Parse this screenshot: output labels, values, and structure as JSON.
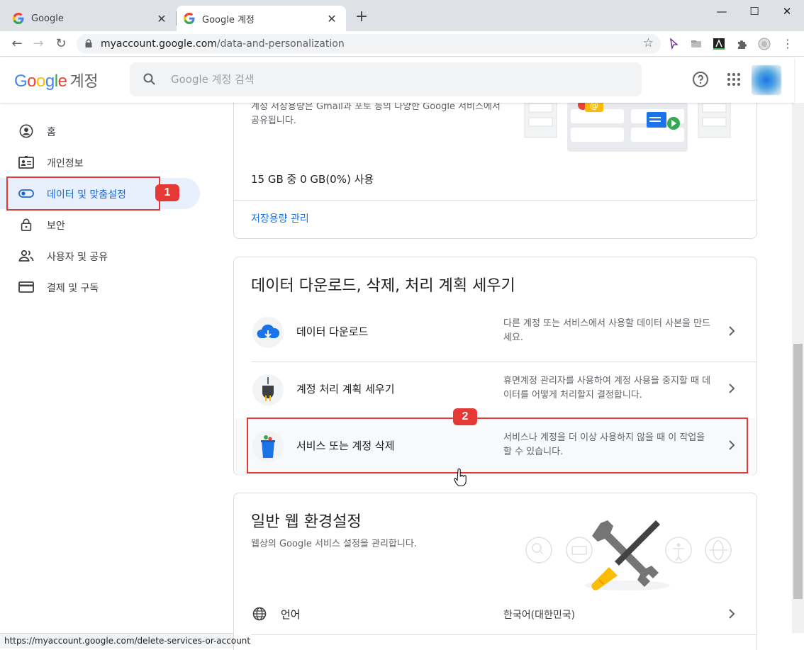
{
  "browser": {
    "tabs": [
      {
        "label": "Google",
        "active": false
      },
      {
        "label": "Google 계정",
        "active": true
      }
    ],
    "new_tab_label": "+",
    "url_domain": "myaccount.google.com",
    "url_path": "/data-and-personalization",
    "status_url": "https://myaccount.google.com/delete-services-or-account"
  },
  "header": {
    "logo_text": "Google",
    "account_label": "계정",
    "search_placeholder": "Google 계정 검색"
  },
  "sidebar": {
    "items": [
      {
        "label": "홈",
        "icon": "account-circle-icon"
      },
      {
        "label": "개인정보",
        "icon": "id-card-icon"
      },
      {
        "label": "데이터 및 맞춤설정",
        "icon": "toggle-icon",
        "active": true
      },
      {
        "label": "보안",
        "icon": "lock-icon"
      },
      {
        "label": "사용자 및 공유",
        "icon": "people-icon"
      },
      {
        "label": "결제 및 구독",
        "icon": "credit-card-icon"
      }
    ]
  },
  "annotations": {
    "badge1": "1",
    "badge2": "2",
    "accent": "#e53935"
  },
  "storage_card": {
    "description": "계정 저장용량은 Gmail과 포토 등의 다양한 Google 서비스에서 공유됩니다.",
    "usage": "15 GB 중 0 GB(0%) 사용",
    "usage_fraction": 0,
    "manage_link": "저장용량 관리"
  },
  "data_card": {
    "title": "데이터 다운로드, 삭제, 처리 계획 세우기",
    "rows": [
      {
        "title": "데이터 다운로드",
        "desc": "다른 계정 또는 서비스에서 사용할 데이터 사본을 만드세요.",
        "icon": "cloud-download-icon"
      },
      {
        "title": "계정 처리 계획 세우기",
        "desc": "휴면계정 관리자를 사용하여 계정 사용을 중지할 때 데이터를 어떻게 처리할지 결정합니다.",
        "icon": "plug-icon"
      },
      {
        "title": "서비스 또는 계정 삭제",
        "desc": "서비스나 계정을 더 이상 사용하지 않을 때 이 작업을 할 수 있습니다.",
        "icon": "trash-can-icon"
      }
    ]
  },
  "web_card": {
    "title": "일반 웹 환경설정",
    "subtitle": "웹상의 Google 서비스 설정을 관리합니다.",
    "language_label": "언어",
    "language_value": "한국어(대한민국)"
  },
  "colors": {
    "active_blue": "#1967d2",
    "link_blue": "#1a73e8",
    "active_bg": "#e8f0fe"
  }
}
